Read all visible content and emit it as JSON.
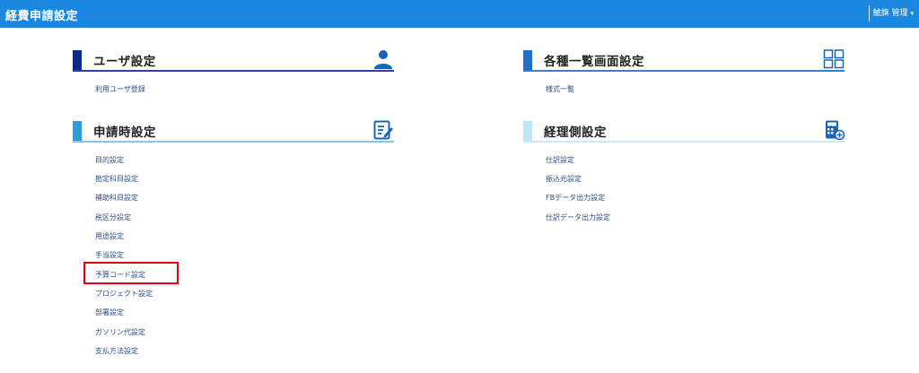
{
  "header": {
    "title": "経費申請設定",
    "user_label": "鯱旗 管理",
    "caret": "▾"
  },
  "sections": {
    "user": {
      "title": "ユーザ設定",
      "bar_color": "#0b2b8c",
      "line_color": "#3a3aa8",
      "icon": "user-icon",
      "items": [
        "利用ユーザ登録"
      ]
    },
    "apply": {
      "title": "申請時設定",
      "bar_color": "#2e9cdc",
      "line_color": "#8cc4e8",
      "icon": "edit-document-icon",
      "items": [
        "目的設定",
        "勘定科目設定",
        "補助科目設定",
        "税区分設定",
        "用途設定",
        "手当設定",
        "予算コード設定",
        "プロジェクト設定",
        "部署設定",
        "ガソリン代設定",
        "支払方法設定"
      ]
    },
    "lists": {
      "title": "各種一覧画面設定",
      "bar_color": "#1e6fd0",
      "line_color": "#3a7fd0",
      "icon": "grid-icon",
      "items": [
        "様式一覧"
      ]
    },
    "accounting": {
      "title": "経理側設定",
      "bar_color": "#bfe6f6",
      "line_color": "#cfeaf6",
      "icon": "calculator-icon",
      "items": [
        "仕訳設定",
        "振込元設定",
        "FBデータ出力設定",
        "仕訳データ出力設定"
      ]
    }
  },
  "highlight_color": "#e60012"
}
